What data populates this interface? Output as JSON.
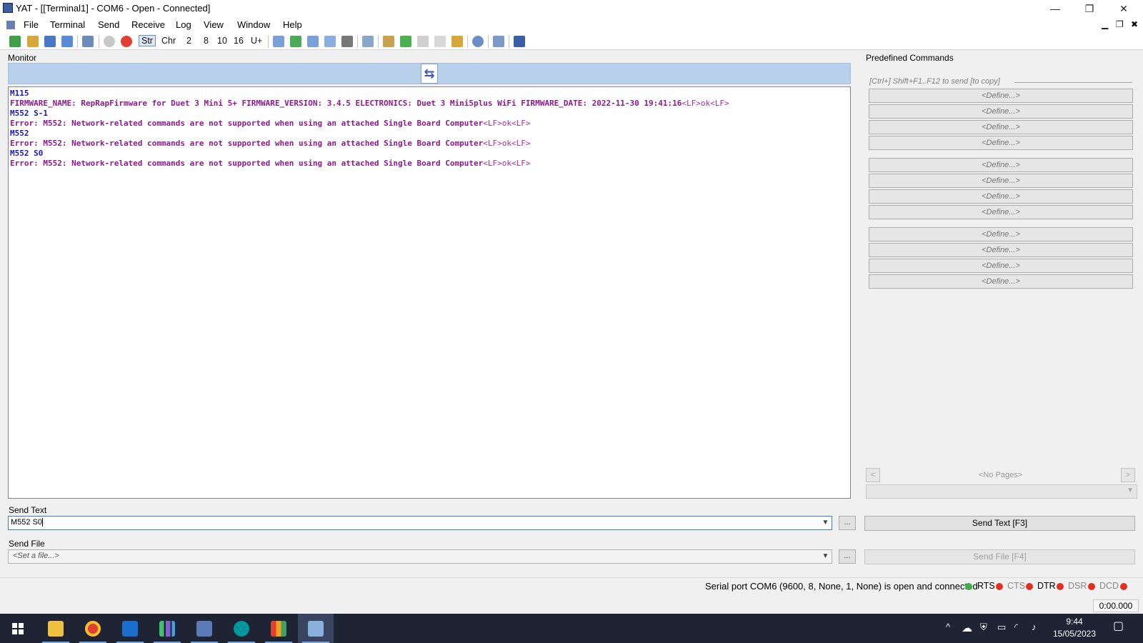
{
  "window": {
    "title": "YAT - [[Terminal1] - COM6 - Open - Connected]",
    "controls": {
      "minimize": "—",
      "restore": "❐",
      "close": "✕"
    }
  },
  "menubar": {
    "items": [
      "File",
      "Terminal",
      "Send",
      "Receive",
      "Log",
      "View",
      "Window",
      "Help"
    ],
    "mdi_controls": {
      "minimize": "▁",
      "restore": "❐",
      "close": "✖"
    }
  },
  "toolbar": {
    "radix": [
      "Str",
      "Chr",
      "2",
      "8",
      "10",
      "16",
      "U+"
    ],
    "active_radix": "Str"
  },
  "monitor": {
    "label": "Monitor",
    "lines": [
      {
        "type": "tx",
        "text": "M115",
        "suffix": ""
      },
      {
        "type": "rx",
        "text": "FIRMWARE_NAME: RepRapFirmware for Duet 3 Mini 5+ FIRMWARE_VERSION: 3.4.5 ELECTRONICS: Duet 3 Mini5plus WiFi FIRMWARE_DATE: 2022-11-30 19:41:16",
        "suffix": "<LF>ok<LF>"
      },
      {
        "type": "tx",
        "text": "M552 S-1",
        "suffix": ""
      },
      {
        "type": "rx",
        "text": "Error: M552: Network-related commands are not supported when using an attached Single Board Computer",
        "suffix": "<LF>ok<LF>"
      },
      {
        "type": "tx",
        "text": "M552",
        "suffix": ""
      },
      {
        "type": "rx",
        "text": "Error: M552: Network-related commands are not supported when using an attached Single Board Computer",
        "suffix": "<LF>ok<LF>"
      },
      {
        "type": "tx",
        "text": "M552 S0",
        "suffix": ""
      },
      {
        "type": "rx",
        "text": "Error: M552: Network-related commands are not supported when using an attached Single Board Computer",
        "suffix": "<LF>ok<LF>"
      }
    ]
  },
  "predefined": {
    "label": "Predefined Commands",
    "hint": "[Ctrl+] Shift+F1..F12 to send [to copy]",
    "buttons": [
      "<Define...>",
      "<Define...>",
      "<Define...>",
      "<Define...>",
      "<Define...>",
      "<Define...>",
      "<Define...>",
      "<Define...>",
      "<Define...>",
      "<Define...>",
      "<Define...>",
      "<Define...>"
    ],
    "pages_label": "<No Pages>",
    "prev": "<",
    "next": ">"
  },
  "send_text": {
    "label": "Send Text",
    "value": "M552 S0",
    "more": "...",
    "button": "Send Text [F3]"
  },
  "send_file": {
    "label": "Send File",
    "placeholder": "<Set a file...>",
    "more": "...",
    "button": "Send File [F4]"
  },
  "status": {
    "text": "Serial port COM6 (9600, 8, None, 1, None) is open and connected",
    "signals": [
      {
        "name": "RTS",
        "active": true,
        "color": "#e03020"
      },
      {
        "name": "CTS",
        "active": false,
        "color": "#e03020"
      },
      {
        "name": "DTR",
        "active": true,
        "color": "#e03020"
      },
      {
        "name": "DSR",
        "active": false,
        "color": "#e03020"
      },
      {
        "name": "DCD",
        "active": false,
        "color": "#e03020"
      }
    ],
    "connection_led": "#3cb043",
    "timer": "0:00.000"
  },
  "taskbar": {
    "apps": [
      "file-explorer-icon",
      "chrome-icon",
      "outlook-icon",
      "app-bars-icon",
      "network-app-icon",
      "arduino-icon",
      "tiles-app-icon",
      "yat-icon"
    ],
    "tray": {
      "chevron": "^"
    },
    "clock": {
      "time": "9:44",
      "date": "15/05/2023"
    }
  }
}
